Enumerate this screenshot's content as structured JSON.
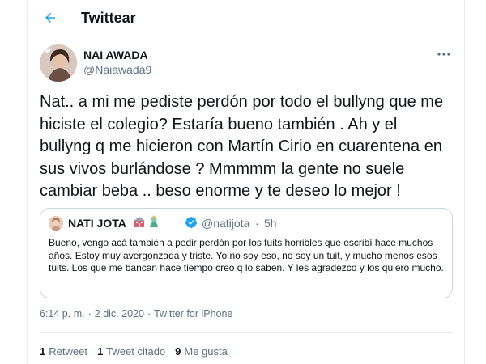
{
  "header": {
    "title": "Twittear",
    "back_icon": "arrow-left-icon"
  },
  "author": {
    "name": "NAI AWADA",
    "handle": "@Naiawada9",
    "more_icon": "more-dots-icon"
  },
  "tweet": {
    "text": "Nat.. a mi me pediste perdón por todo el bullyng que me hiciste el colegio? Estaría bueno también . Ah y el bullyng q me hicieron con Martín Cirio en cuarentena en sus vivos burlándose ? Mmmmm la gente no suele cambiar beba .. beso enorme y te deseo lo mejor !"
  },
  "quote": {
    "name": "NATI JOTA",
    "emoji_icons": [
      "building-emoji",
      "genie-emoji"
    ],
    "verified_icon": "verified-badge-icon",
    "handle": "@natijota",
    "separator": "·",
    "time": "5h",
    "text": "Bueno, vengo acá también a pedir perdón por los tuits horribles que escribí hace muchos años. Estoy muy avergonzada y triste. Yo no soy eso, no soy un tuit, y mucho menos esos tuits. Los que me bancan hace tiempo creo q lo saben. Y les agradezco y los quiero mucho."
  },
  "meta": {
    "time": "6:14 p. m.",
    "separator": "·",
    "date": "2 dic. 2020",
    "separator2": "·",
    "source": "Twitter for iPhone"
  },
  "stats": {
    "retweets_count": "1",
    "retweets_label": "Retweet",
    "quotes_count": "1",
    "quotes_label": "Tweet citado",
    "likes_count": "9",
    "likes_label": "Me gusta"
  },
  "colors": {
    "accent": "#1da1f2",
    "muted": "#5b7083",
    "border": "#e6ecf0"
  }
}
